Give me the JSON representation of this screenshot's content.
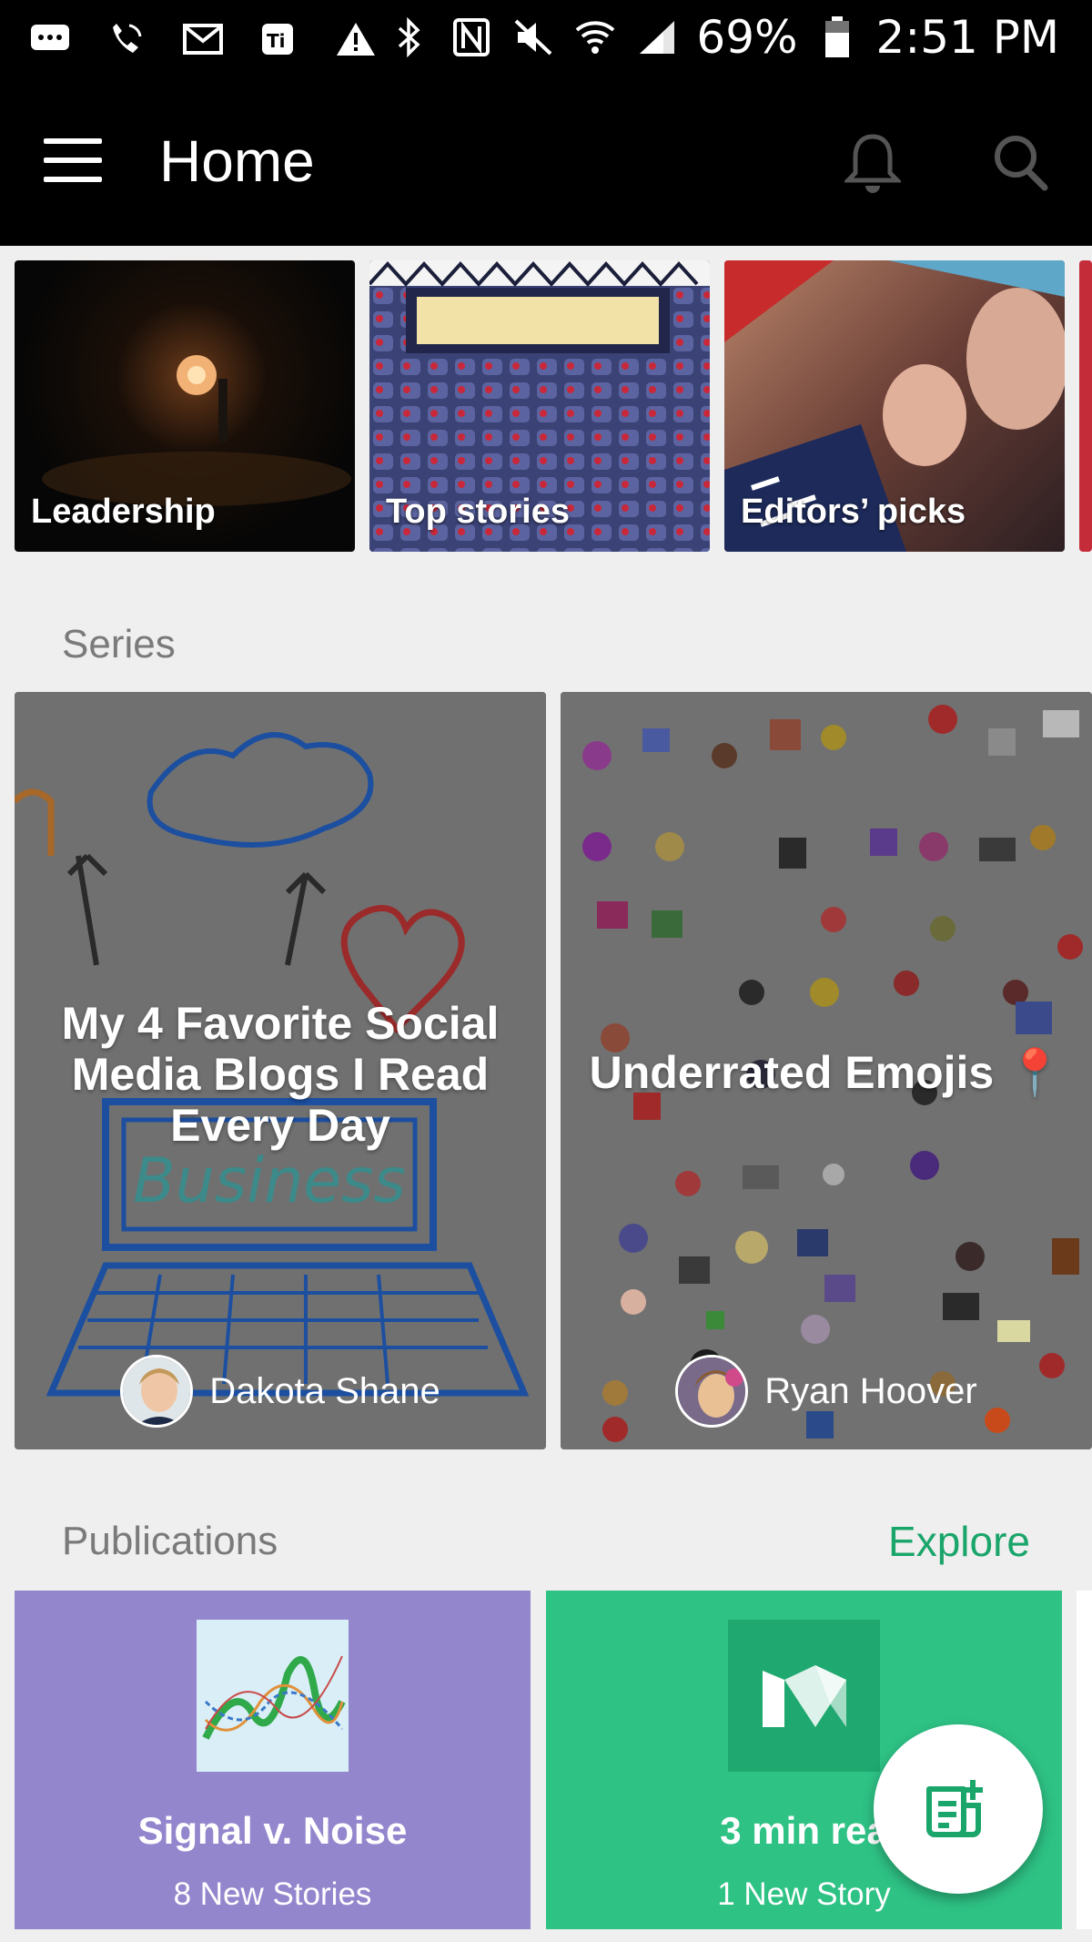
{
  "status_bar": {
    "battery": "69%",
    "time": "2:51 PM"
  },
  "app_bar": {
    "title": "Home"
  },
  "topics": [
    {
      "label": "Leadership"
    },
    {
      "label": "Top stories"
    },
    {
      "label": "Editors’ picks"
    }
  ],
  "series_section": {
    "title": "Series",
    "items": [
      {
        "title": "My 4 Favorite Social Media Blogs I Read Every Day",
        "author": "Dakota Shane"
      },
      {
        "title": "Underrated Emojis 📍",
        "author": "Ryan Hoover"
      }
    ]
  },
  "publications_section": {
    "title": "Publications",
    "explore_label": "Explore",
    "items": [
      {
        "name": "Signal v. Noise",
        "count": "8 New Stories",
        "color": "#9486cd"
      },
      {
        "name": "3 min rea",
        "count": "1 New Story",
        "color": "#2ec285"
      }
    ]
  },
  "colors": {
    "accent": "#1aa56a",
    "bar": "#000000",
    "background": "#efefef"
  }
}
